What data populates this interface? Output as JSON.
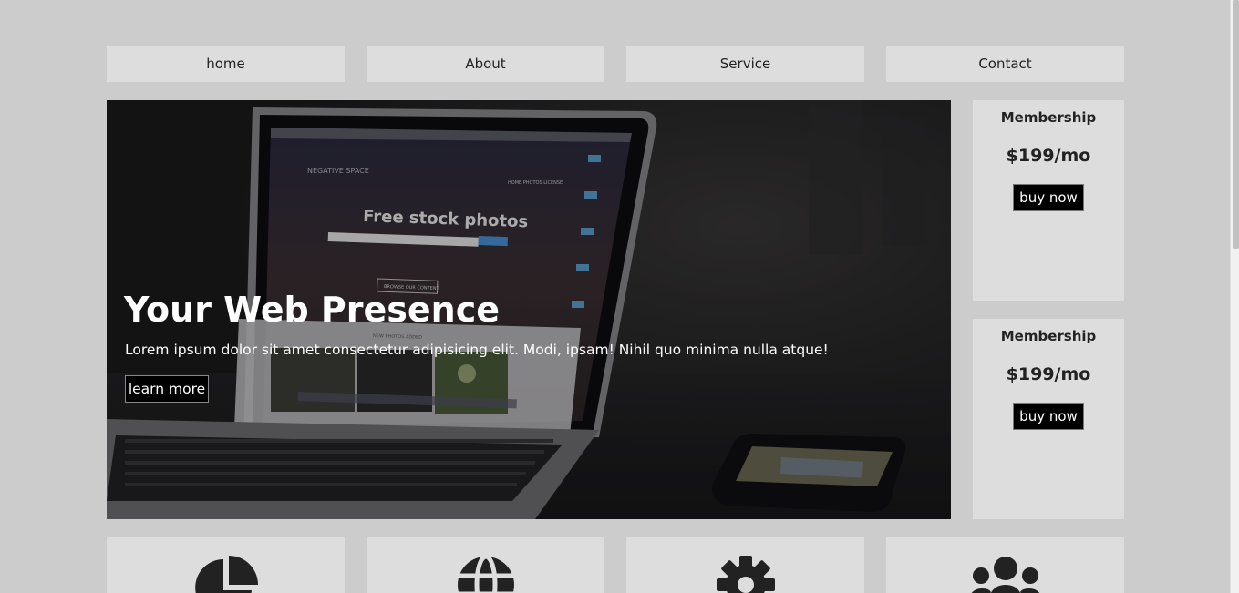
{
  "nav": {
    "items": [
      {
        "label": "home"
      },
      {
        "label": "About"
      },
      {
        "label": "Service"
      },
      {
        "label": "Contact"
      }
    ]
  },
  "hero": {
    "title": "Your Web Presence",
    "text": "Lorem ipsum dolor sit amet consectetur adipisicing elit. Modi, ipsam! Nihil quo minima nulla atque!",
    "button_label": "learn more",
    "image": {
      "screen_heading": "Free stock photos",
      "screen_brand": "NEGATIVE SPACE",
      "screen_menu": "HOME   PHOTOS   LICENSE",
      "screen_cta": "BROWSE OUR CONTENT",
      "screen_section": "NEW PHOTOS ADDED"
    }
  },
  "cards": [
    {
      "title": "Membership",
      "price": "$199/mo",
      "button_label": "buy now"
    },
    {
      "title": "Membership",
      "price": "$199/mo",
      "button_label": "buy now"
    }
  ],
  "features": [
    {
      "icon": "pie-chart-icon"
    },
    {
      "icon": "globe-icon"
    },
    {
      "icon": "gear-icon"
    },
    {
      "icon": "users-icon"
    }
  ],
  "colors": {
    "background": "#cccccc",
    "panel": "#dddddd",
    "button": "#000000",
    "icon": "#222222"
  }
}
